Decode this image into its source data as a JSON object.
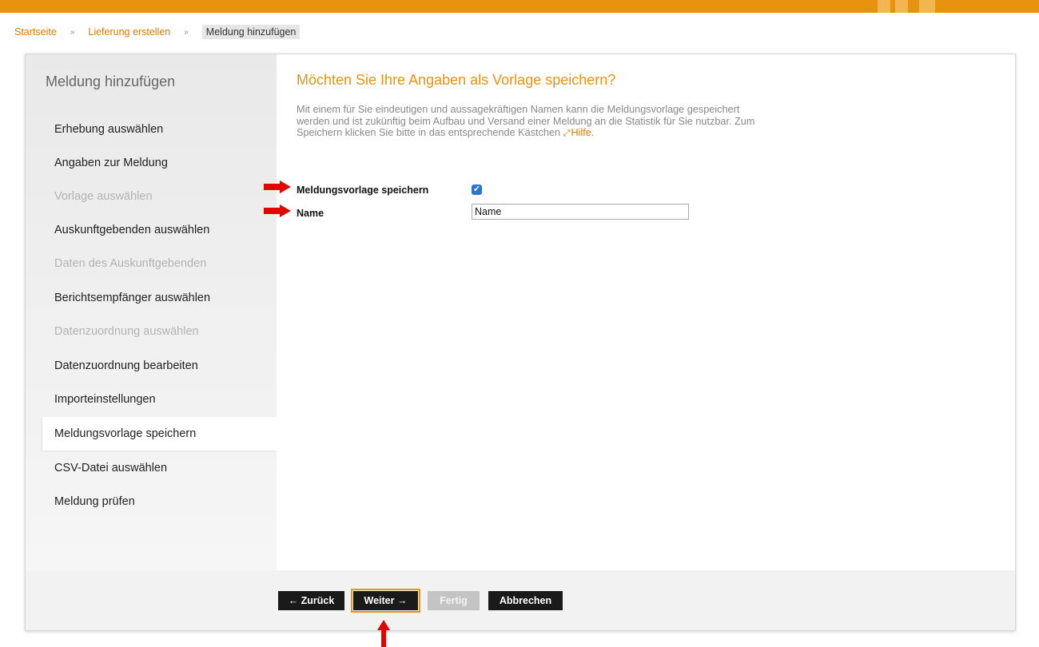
{
  "breadcrumb": {
    "items": [
      "Startseite",
      "Lieferung erstellen"
    ],
    "current": "Meldung hinzufügen",
    "separator": "»"
  },
  "sidebar": {
    "title": "Meldung hinzufügen",
    "items": [
      {
        "label": "Erhebung auswählen",
        "state": "enabled"
      },
      {
        "label": "Angaben zur Meldung",
        "state": "enabled"
      },
      {
        "label": "Vorlage auswählen",
        "state": "disabled"
      },
      {
        "label": "Auskunftgebenden auswählen",
        "state": "enabled"
      },
      {
        "label": "Daten des Auskunftgebenden",
        "state": "disabled"
      },
      {
        "label": "Berichtsempfänger auswählen",
        "state": "enabled"
      },
      {
        "label": "Datenzuordnung auswählen",
        "state": "disabled"
      },
      {
        "label": "Datenzuordnung bearbeiten",
        "state": "enabled"
      },
      {
        "label": "Importeinstellungen",
        "state": "enabled"
      },
      {
        "label": "Meldungsvorlage speichern",
        "state": "active"
      },
      {
        "label": "CSV-Datei auswählen",
        "state": "enabled"
      },
      {
        "label": "Meldung prüfen",
        "state": "enabled"
      }
    ]
  },
  "main": {
    "heading": "Möchten Sie Ihre Angaben als Vorlage speichern?",
    "description": "Mit einem für Sie eindeutigen und aussagekräftigen Namen kann die Meldungsvorlage gespeichert werden und ist zukünftig beim Aufbau und Versand einer Meldung an die Statistik für Sie nutzbar. Zum Speichern klicken Sie bitte in das entsprechende Kästchen",
    "help_link": "Hilfe",
    "help_suffix": ".",
    "save_label": "Meldungsvorlage speichern",
    "save_checked": true,
    "name_label": "Name",
    "name_value": "Name"
  },
  "footer": {
    "back": "← Zurück",
    "next": "Weiter →",
    "finish": "Fertig",
    "cancel": "Abbrechen"
  },
  "colors": {
    "accent": "#e8930f",
    "annotation_arrow": "#e60000",
    "checkbox": "#2c73d6"
  }
}
